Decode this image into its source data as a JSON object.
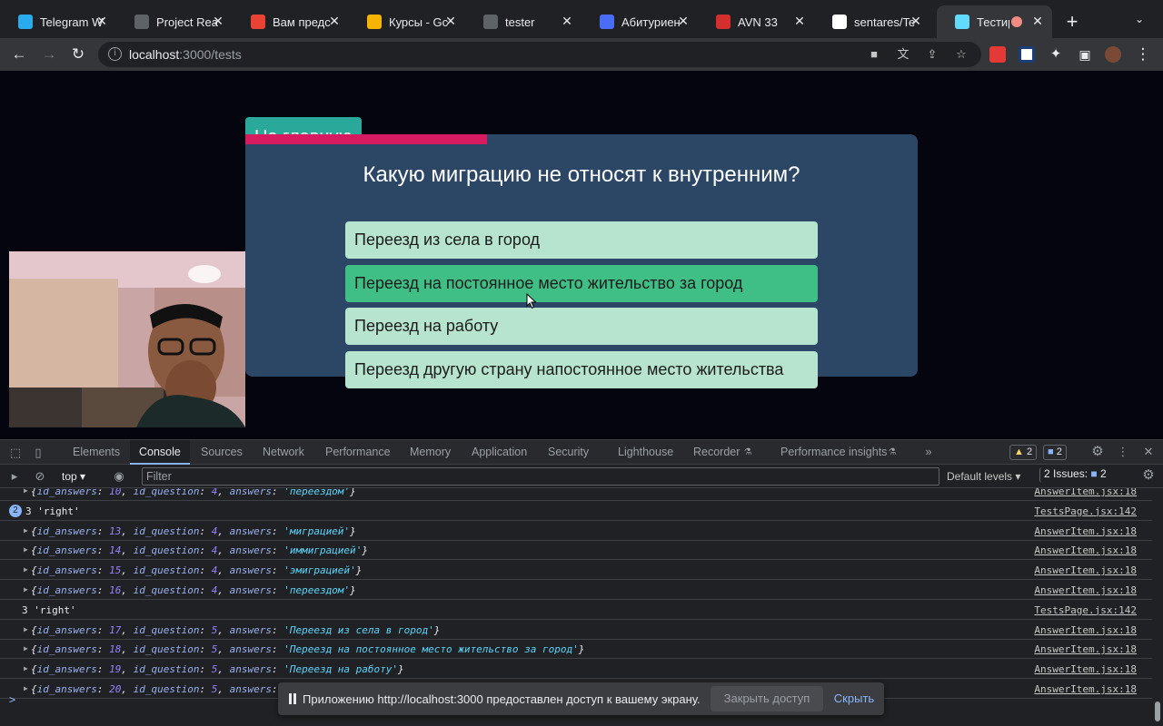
{
  "browser": {
    "tabs": [
      {
        "title": "Telegram W",
        "favicon": "telegram-icon",
        "color": "#2AABEE"
      },
      {
        "title": "Project Rea",
        "favicon": "monitor-icon",
        "color": "#5f6368"
      },
      {
        "title": "Вам предс",
        "favicon": "gmail-icon",
        "color": "#EA4335"
      },
      {
        "title": "Курсы - Gc",
        "favicon": "slides-icon",
        "color": "#F4B400"
      },
      {
        "title": "tester",
        "favicon": "monitor-icon",
        "color": "#5f6368"
      },
      {
        "title": "Абитуриен",
        "favicon": "university-icon",
        "color": "#4a6cf7"
      },
      {
        "title": "AVN 33",
        "favicon": "avn-icon",
        "color": "#d32f2f"
      },
      {
        "title": "sentares/Te",
        "favicon": "github-icon",
        "color": "#ffffff"
      },
      {
        "title": "Тестир",
        "favicon": "react-icon",
        "color": "#61dafb",
        "active": true
      }
    ],
    "new_tab": "+",
    "url": {
      "host": "localhost",
      "path": ":3000/tests"
    }
  },
  "page": {
    "home_button": "На главную",
    "question": "Какую миграцию не относят к внутренним?",
    "progress_fraction": 0.36,
    "answers": [
      {
        "label": "Переезд из села в город",
        "hover": false
      },
      {
        "label": "Переезд на постоянное место жительство за город",
        "hover": true
      },
      {
        "label": "Переезд на работу",
        "hover": false
      },
      {
        "label": "Переезд другую страну напостоянное место жительства",
        "hover": false
      }
    ]
  },
  "devtools": {
    "tabs": [
      "Elements",
      "Console",
      "Sources",
      "Network",
      "Performance",
      "Memory",
      "Application",
      "Security",
      "Lighthouse",
      "Recorder",
      "Performance insights"
    ],
    "active_tab": "Console",
    "warnings_count": "2",
    "messages_count": "2",
    "context": "top",
    "filter_placeholder": "Filter",
    "levels": "Default levels",
    "issues_label": "2 Issues:",
    "issues_count": "2",
    "console_rows": [
      {
        "type": "obj",
        "id": "10",
        "q": "4",
        "ans": "переездом",
        "src": "AnswerItem.jsx:18",
        "partial": true
      },
      {
        "type": "log",
        "count": "2",
        "text": "3 'right'",
        "src": "TestsPage.jsx:142"
      },
      {
        "type": "obj",
        "id": "13",
        "q": "4",
        "ans": "миграцией",
        "src": "AnswerItem.jsx:18"
      },
      {
        "type": "obj",
        "id": "14",
        "q": "4",
        "ans": "иммиграцией",
        "src": "AnswerItem.jsx:18"
      },
      {
        "type": "obj",
        "id": "15",
        "q": "4",
        "ans": "эмиграцией",
        "src": "AnswerItem.jsx:18"
      },
      {
        "type": "obj",
        "id": "16",
        "q": "4",
        "ans": "переездом",
        "src": "AnswerItem.jsx:18"
      },
      {
        "type": "log",
        "text": "3 'right'",
        "src": "TestsPage.jsx:142"
      },
      {
        "type": "obj",
        "id": "17",
        "q": "5",
        "ans": "Переезд из села в город",
        "src": "AnswerItem.jsx:18"
      },
      {
        "type": "obj",
        "id": "18",
        "q": "5",
        "ans": "Переезд на постоянное место жительство за город",
        "src": "AnswerItem.jsx:18"
      },
      {
        "type": "obj",
        "id": "19",
        "q": "5",
        "ans": "Переезд на работу",
        "src": "AnswerItem.jsx:18"
      },
      {
        "type": "obj",
        "id": "20",
        "q": "5",
        "ans": "",
        "src": "AnswerItem.jsx:18",
        "hidden_tail": true
      }
    ],
    "prompt": ">"
  },
  "share_bar": {
    "text": "Приложению http://localhost:3000 предоставлен доступ к вашему экрану.",
    "stop_label": "Закрыть доступ",
    "hide_label": "Скрыть"
  }
}
